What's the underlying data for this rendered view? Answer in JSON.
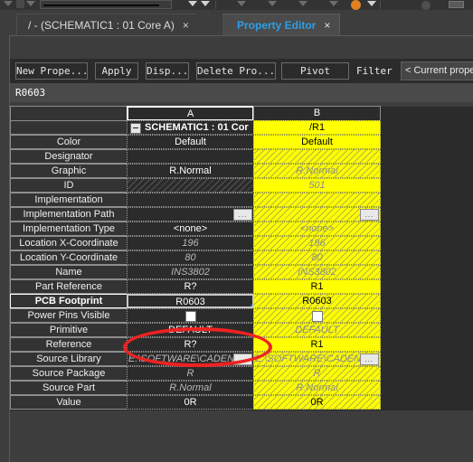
{
  "window": {
    "app_title": "Property Editor"
  },
  "top_toolbar": {
    "icons": [
      "cursor-arrow-icon",
      "rectangle-select-icon",
      "zoom-area-icon",
      "combo-dropdown",
      "chevron-down-icon",
      "chevron-down-icon",
      "wire-icon",
      "net-alias-icon",
      "bus-icon",
      "junction-icon",
      "orange-marker-icon",
      "chevron-down-icon",
      "no-connect-icon",
      "circle-icon",
      "box-icon"
    ]
  },
  "tabs": [
    {
      "label": "/ - (SCHEMATIC1 : 01 Core A)",
      "active": false,
      "close": "×"
    },
    {
      "label": "Property Editor",
      "active": true,
      "close": "×"
    }
  ],
  "toolbar": {
    "new_property_label": "New Prope...",
    "apply_label": "Apply",
    "display_label": "Disp...",
    "delete_property_label": "Delete Pro...",
    "pivot_label": "Pivot",
    "filter_label": "Filter",
    "filter_selected": "< Current properti",
    "filter_options": [
      "< Current properti"
    ]
  },
  "name_field": {
    "value": "R0603",
    "placeholder": ""
  },
  "grid": {
    "columns": [
      {
        "id": "label",
        "header": ""
      },
      {
        "id": "A",
        "header": "A",
        "selected": true
      },
      {
        "id": "B",
        "header": "B",
        "selected": false
      }
    ],
    "title_row": {
      "label": "",
      "a": "SCHEMATIC1 : 01 Cor",
      "b": "/R1",
      "expand_state": "expanded"
    },
    "rows": [
      {
        "label": "Color",
        "a": "Default",
        "a_style": "normal",
        "b": "Default",
        "b_style": "normal"
      },
      {
        "label": "Designator",
        "a": "",
        "a_style": "normal",
        "b": "",
        "b_style": "readonly"
      },
      {
        "label": "Graphic",
        "a": "R.Normal",
        "a_style": "normal",
        "b": "R.Normal",
        "b_style": "readonly-italic"
      },
      {
        "label": "ID",
        "a": "",
        "a_style": "readonly",
        "b": "501",
        "b_style": "italic"
      },
      {
        "label": "Implementation",
        "a": "",
        "a_style": "normal",
        "b": "",
        "b_style": "readonly"
      },
      {
        "label": "Implementation Path",
        "a": "",
        "a_style": "browse",
        "b": "",
        "b_style": "readonly-browse"
      },
      {
        "label": "Implementation Type",
        "a": "<none>",
        "a_style": "normal",
        "b": "<none>",
        "b_style": "readonly-italic"
      },
      {
        "label": "Location X-Coordinate",
        "a": "196",
        "a_style": "italic",
        "b": "196",
        "b_style": "readonly-italic"
      },
      {
        "label": "Location Y-Coordinate",
        "a": "80",
        "a_style": "italic",
        "b": "80",
        "b_style": "readonly-italic"
      },
      {
        "label": "Name",
        "a": "INS3802",
        "a_style": "italic",
        "b": "INS3802",
        "b_style": "readonly-italic"
      },
      {
        "label": "Part Reference",
        "a": "R?",
        "a_style": "normal",
        "b": "R1",
        "b_style": "normal"
      },
      {
        "label": "PCB Footprint",
        "a": "R0603",
        "a_style": "selected",
        "b": "R0603",
        "b_style": "readonly"
      },
      {
        "label": "Power Pins Visible",
        "a": "",
        "a_style": "checkbox",
        "b": "",
        "b_style": "readonly-checkbox"
      },
      {
        "label": "Primitive",
        "a": "DEFAULT",
        "a_style": "normal",
        "b": "DEFAULT",
        "b_style": "readonly-italic"
      },
      {
        "label": "Reference",
        "a": "R?",
        "a_style": "normal",
        "b": "R1",
        "b_style": "normal"
      },
      {
        "label": "Source Library",
        "a": "E:\\SOFTWARE\\CADEN",
        "a_style": "italic-browse",
        "b": "E:\\SOFTWARE\\CADEN",
        "b_style": "readonly-italic-browse"
      },
      {
        "label": "Source Package",
        "a": "R",
        "a_style": "italic",
        "b": "R",
        "b_style": "readonly-italic"
      },
      {
        "label": "Source Part",
        "a": "R.Normal",
        "a_style": "italic",
        "b": "R.Normal",
        "b_style": "readonly-italic"
      },
      {
        "label": "Value",
        "a": "0R",
        "a_style": "normal",
        "b": "0R",
        "b_style": "readonly"
      }
    ]
  },
  "annotation": {
    "type": "ellipse-highlight",
    "color": "#ee2222",
    "targets": "PCB Footprint value cell in column A"
  },
  "colors": {
    "background": "#2b2b2b",
    "panel": "#3d3d3d",
    "active_tab_text": "#2b9fe8",
    "column_b_fill": "#ffff00",
    "grid_line": "#8d8d8d",
    "annotation": "#ee2222"
  }
}
